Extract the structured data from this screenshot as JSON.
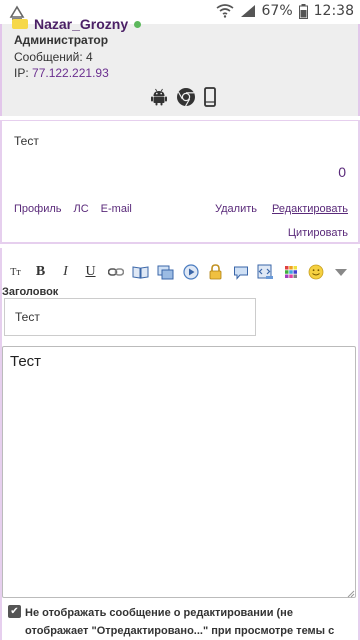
{
  "status_bar": {
    "battery": "67%",
    "time": "12:38"
  },
  "user": {
    "name": "Nazar_Grozny",
    "role": "Администратор",
    "messages": "Сообщений: 4",
    "ip_label": "IP:",
    "ip": "77.122.221.93",
    "platform_icons": [
      "android-icon",
      "chrome-icon",
      "phone-icon"
    ]
  },
  "post": {
    "text": "Тест",
    "rating": "0",
    "links_left": [
      "Профиль",
      "ЛС",
      "E-mail"
    ],
    "delete": "Удалить",
    "edit": "Редактировать",
    "quote": "Цитировать"
  },
  "editor": {
    "toolbar": {
      "text_size": "Tт",
      "bold": "B",
      "italic": "I",
      "underline": "U"
    },
    "title_label": "Заголовок",
    "title_value": "Тест",
    "body_value": "Тест",
    "checkbox_label": "Не отображать сообщение о редактировании (не отображает \"Отредактировано...\" при просмотре темы с"
  },
  "colors": {
    "accent": "#5a2a7a",
    "border": "#e6cfee",
    "panel": "#eeeeee"
  }
}
